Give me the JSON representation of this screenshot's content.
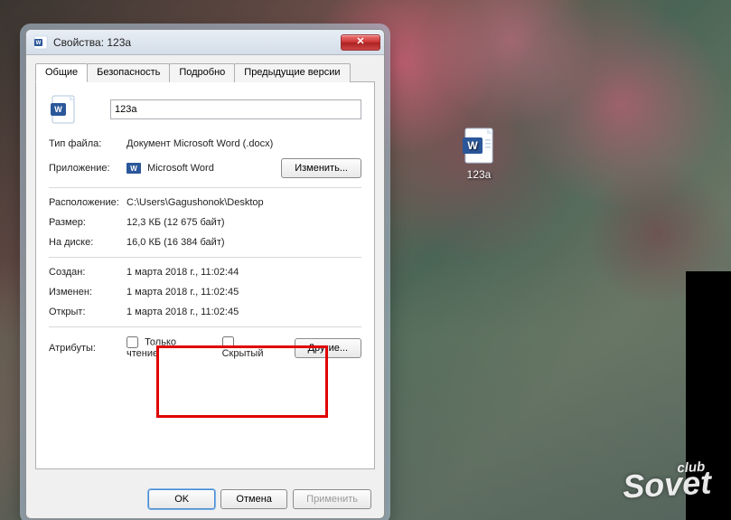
{
  "window": {
    "title": "Свойства: 123a"
  },
  "tabs": {
    "general": "Общие",
    "security": "Безопасность",
    "details": "Подробно",
    "previous": "Предыдущие версии"
  },
  "file": {
    "name": "123a",
    "type_label": "Тип файла:",
    "type_value": "Документ Microsoft Word (.docx)",
    "app_label": "Приложение:",
    "app_value": "Microsoft Word",
    "change_btn": "Изменить...",
    "location_label": "Расположение:",
    "location_value": "C:\\Users\\Gagushonok\\Desktop",
    "size_label": "Размер:",
    "size_value": "12,3 КБ (12 675 байт)",
    "disk_label": "На диске:",
    "disk_value": "16,0 КБ (16 384 байт)",
    "created_label": "Создан:",
    "created_value": "1 марта 2018 г., 11:02:44",
    "modified_label": "Изменен:",
    "modified_value": "1 марта 2018 г., 11:02:45",
    "accessed_label": "Открыт:",
    "accessed_value": "1 марта 2018 г., 11:02:45",
    "attr_label": "Атрибуты:",
    "readonly": "Только чтение",
    "hidden": "Скрытый",
    "other_btn": "Другие..."
  },
  "buttons": {
    "ok": "OK",
    "cancel": "Отмена",
    "apply": "Применить"
  },
  "desktop": {
    "icon_label": "123a"
  },
  "watermark": {
    "top": "club",
    "main": "Sovet"
  }
}
